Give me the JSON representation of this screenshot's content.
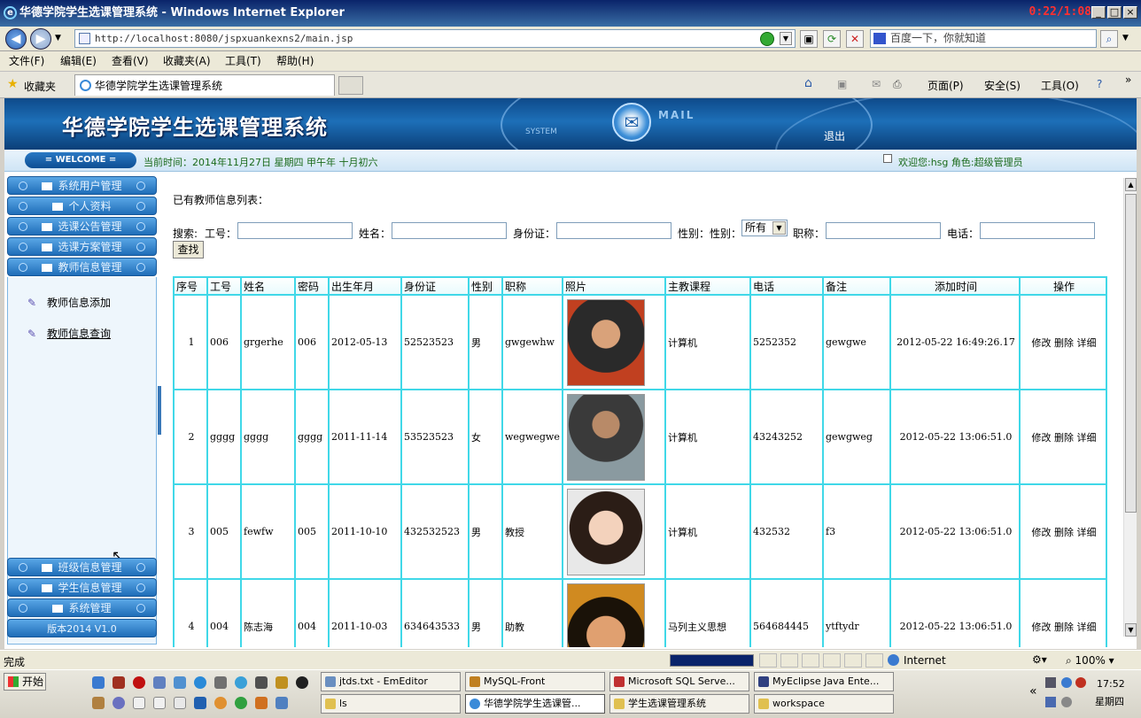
{
  "browser": {
    "window_title": "华德学院学生选课管理系统 - Windows Internet Explorer",
    "timer": "0:22/1:08",
    "address": "http://localhost:8080/jspxuankexns2/main.jsp",
    "search_placeholder": "百度一下，你就知道",
    "menu": [
      "文件(F)",
      "编辑(E)",
      "查看(V)",
      "收藏夹(A)",
      "工具(T)",
      "帮助(H)"
    ],
    "favorites_label": "收藏夹",
    "tab_title": "华德学院学生选课管理系统",
    "commands": [
      "页面(P)",
      "安全(S)",
      "工具(O)"
    ],
    "status_text": "完成",
    "zone": "Internet",
    "zoom": "100%"
  },
  "app": {
    "system_name": "华德学院学生选课管理系统",
    "system_small": "SYSTEM",
    "mail_label": "MAIL",
    "logout": "退出",
    "welcome": "= WELCOME =",
    "current_time": "当前时间：2014年11月27日 星期四 甲午年 十月初六",
    "user_info": "欢迎您:hsg 角色:超级管理员"
  },
  "sidebar": {
    "top_items": [
      "系统用户管理",
      "个人资料",
      "选课公告管理",
      "选课方案管理",
      "教师信息管理"
    ],
    "sub_items": [
      "教师信息添加",
      "教师信息查询"
    ],
    "bottom_items": [
      "班级信息管理",
      "学生信息管理",
      "系统管理"
    ],
    "version": "版本2014 V1.0"
  },
  "main": {
    "list_title": "已有教师信息列表：",
    "search_label": "搜索:",
    "fields": {
      "gonghao": "工号：",
      "xingming": "姓名：",
      "sfz": "身份证：",
      "xingbie": "性别：性别：",
      "zhicheng": "职称：",
      "dianhua": "电话："
    },
    "gender_option": "所有",
    "find_button": "查找",
    "columns": [
      "序号",
      "工号",
      "姓名",
      "密码",
      "出生年月",
      "身份证",
      "性别",
      "职称",
      "照片",
      "主教课程",
      "电话",
      "备注",
      "添加时间",
      "操作"
    ],
    "rows": [
      {
        "no": "1",
        "gh": "006",
        "name": "grgerhe",
        "pwd": "006",
        "birth": "2012-05-13",
        "id": "52523523",
        "sex": "男",
        "title": "gwgewhw",
        "course": "计算机",
        "phone": "5252352",
        "note": "gewgwe",
        "added": "2012-05-22 16:49:26.17"
      },
      {
        "no": "2",
        "gh": "gggg",
        "name": "gggg",
        "pwd": "gggg",
        "birth": "2011-11-14",
        "id": "53523523",
        "sex": "女",
        "title": "wegwegwe",
        "course": "计算机",
        "phone": "43243252",
        "note": "gewgweg",
        "added": "2012-05-22 13:06:51.0"
      },
      {
        "no": "3",
        "gh": "005",
        "name": "fewfw",
        "pwd": "005",
        "birth": "2011-10-10",
        "id": "432532523",
        "sex": "男",
        "title": "教授",
        "course": "计算机",
        "phone": "432532",
        "note": "f3",
        "added": "2012-05-22 13:06:51.0"
      },
      {
        "no": "4",
        "gh": "004",
        "name": "陈志海",
        "pwd": "004",
        "birth": "2011-10-03",
        "id": "634643533",
        "sex": "男",
        "title": "助教",
        "course": "马列主义思想",
        "phone": "564684445",
        "note": "ytftydr",
        "added": "2012-05-22 13:06:51.0"
      }
    ],
    "actions": [
      "修改",
      "删除",
      "详细"
    ]
  },
  "taskbar": {
    "start": "开始",
    "row1": [
      "jtds.txt - EmEditor",
      "MySQL-Front",
      "Microsoft SQL Serve...",
      "MyEclipse Java Ente..."
    ],
    "row2": [
      "ls",
      "华德学院学生选课管...",
      "学生选课管理系统",
      "workspace"
    ],
    "clock": "17:52",
    "weekday": "星期四"
  }
}
